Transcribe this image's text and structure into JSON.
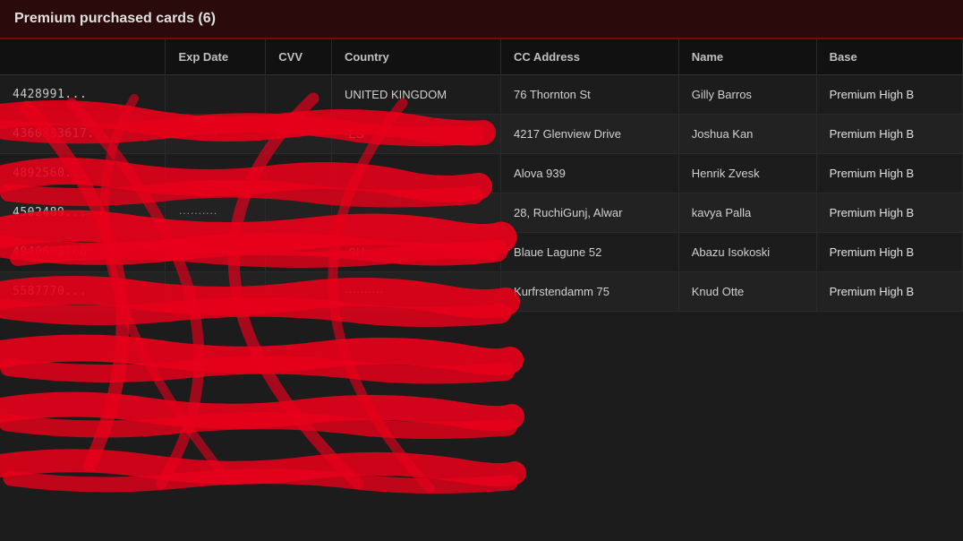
{
  "title": "Premium purchased cards (6)",
  "table": {
    "headers": [
      "",
      "Exp Date",
      "CVV",
      "Country",
      "CC Address",
      "Name",
      "Base"
    ],
    "rows": [
      {
        "cc": "4428991...",
        "exp": "",
        "cvv": "",
        "country": "UNITED KINGDOM",
        "address": "76 Thornton St",
        "name": "Gilly Barros",
        "base": "Premium High B"
      },
      {
        "cc": "4360833617...",
        "exp": "··········",
        "cvv": "",
        "country": "·ES",
        "address": "4217 Glenview Drive",
        "name": "Joshua Kan",
        "base": "Premium High B"
      },
      {
        "cc": "4892560...",
        "exp": "",
        "cvv": "",
        "country": "",
        "address": "Alova 939",
        "name": "Henrik Zvesk",
        "base": "Premium High B"
      },
      {
        "cc": "4502489...",
        "exp": "··········",
        "cvv": "",
        "country": "",
        "address": "28, RuchiGunj, Alwar",
        "name": "kavya Palla",
        "base": "Premium High B"
      },
      {
        "cc": "4940603068...",
        "exp": "",
        "cvv": "",
        "country": "·SH",
        "address": "Blaue Lagune 52",
        "name": "Abazu Isokoski",
        "base": "Premium High B"
      },
      {
        "cc": "5587770...",
        "exp": "",
        "cvv": "",
        "country": "··········",
        "address": "Kurfrstendamm 75",
        "name": "Knud Otte",
        "base": "Premium High B"
      }
    ]
  }
}
